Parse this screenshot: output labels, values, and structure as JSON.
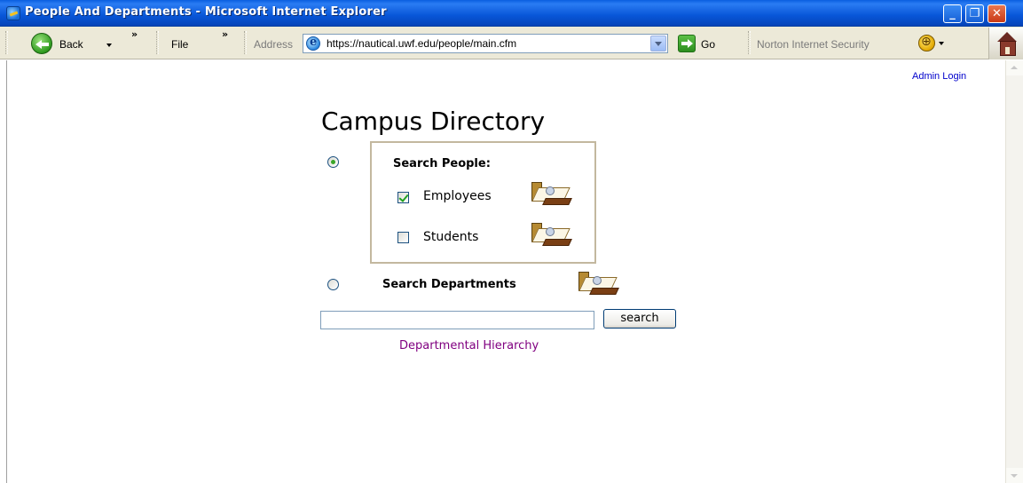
{
  "window": {
    "title": "People And Departments - Microsoft Internet Explorer"
  },
  "toolbar": {
    "back_label": "Back",
    "file_label": "File",
    "address_label": "Address",
    "address_value": "https://nautical.uwf.edu/people/main.cfm",
    "go_label": "Go",
    "norton_label": "Norton Internet Security"
  },
  "page": {
    "admin_login": "Admin Login",
    "heading": "Campus Directory",
    "search_people_label": "Search People:",
    "employees_label": "Employees",
    "students_label": "Students",
    "search_departments_label": "Search Departments",
    "search_button": "search",
    "search_value": "",
    "hierarchy_link": "Departmental Hierarchy",
    "selected_mode": "Search People",
    "employees_checked": true,
    "students_checked": false
  }
}
